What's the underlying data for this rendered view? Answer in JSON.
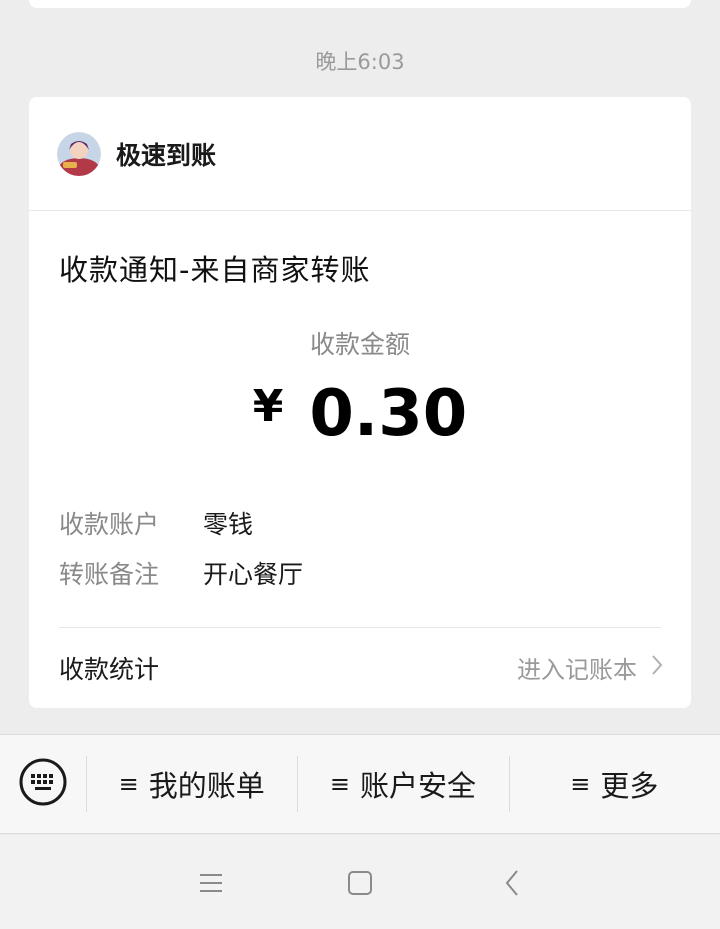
{
  "timestamp": "晚上6:03",
  "header": {
    "name": "极速到账"
  },
  "notice": {
    "title": "收款通知-来自商家转账",
    "amount_label": "收款金额",
    "currency": "¥",
    "amount": "0.30",
    "rows": [
      {
        "key": "收款账户",
        "value": "零钱"
      },
      {
        "key": "转账备注",
        "value": "开心餐厅"
      }
    ],
    "stats_label": "收款统计",
    "stats_link": "进入记账本"
  },
  "menu": {
    "keyboard_icon": "keyboard-icon",
    "bars_glyph": "≡",
    "items": [
      {
        "label": "我的账单"
      },
      {
        "label": "账户安全"
      },
      {
        "label": "更多"
      }
    ]
  },
  "nav": {
    "icons": [
      "menu-icon",
      "home-icon",
      "back-icon"
    ]
  },
  "colors": {
    "background": "#ededed",
    "card": "#ffffff",
    "secondary_text": "#8a8a8a"
  }
}
